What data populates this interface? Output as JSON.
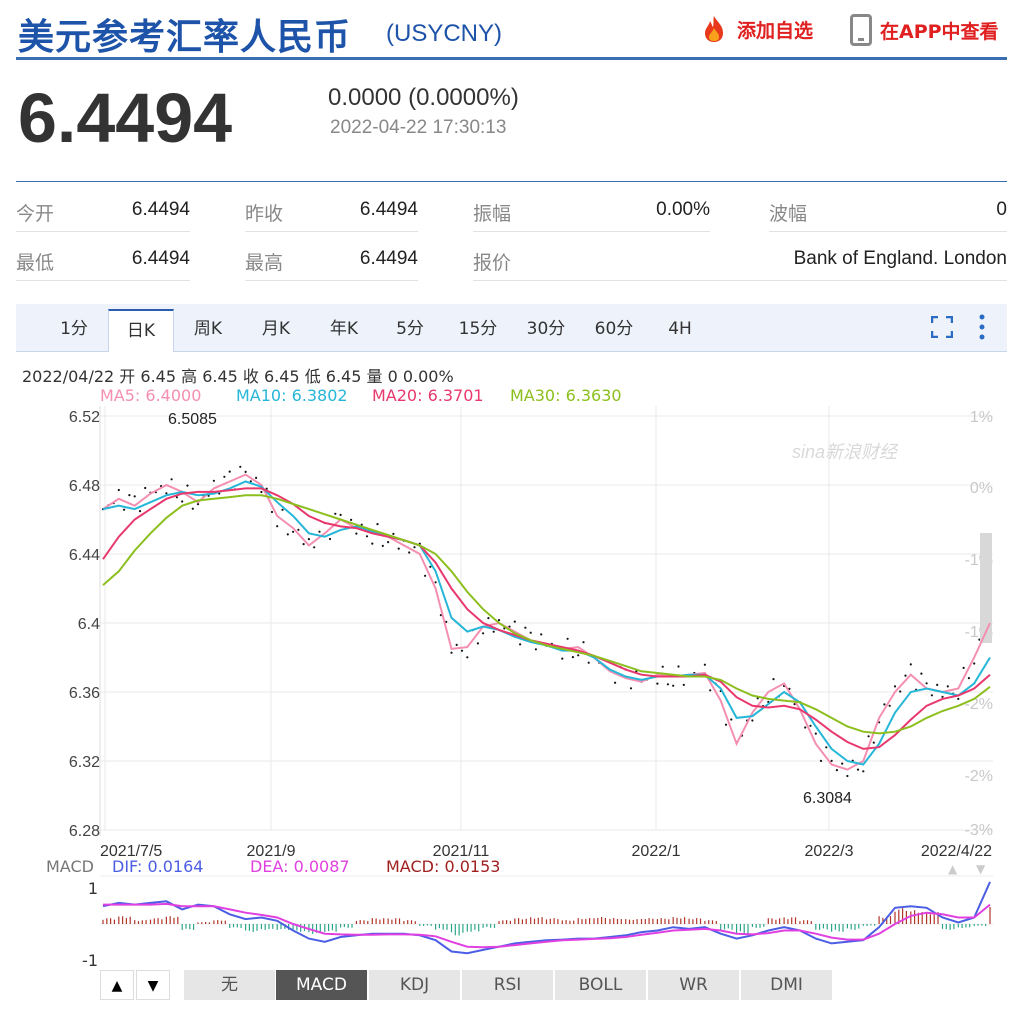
{
  "header": {
    "title": "美元参考汇率人民币",
    "code": "(USYCNY)",
    "add_watch": "添加自选",
    "open_app": "在APP中查看"
  },
  "quote": {
    "price": "6.4494",
    "change": "0.0000 (0.0000%)",
    "timestamp": "2022-04-22 17:30:13"
  },
  "stats": [
    {
      "label": "今开",
      "value": "6.4494"
    },
    {
      "label": "昨收",
      "value": "6.4494"
    },
    {
      "label": "振幅",
      "value": "0.00%"
    },
    {
      "label": "波幅",
      "value": "0"
    },
    {
      "label": "最低",
      "value": "6.4494"
    },
    {
      "label": "最高",
      "value": "6.4494"
    },
    {
      "label": "报价",
      "value": "Bank of England. London"
    }
  ],
  "tabs": [
    "1分",
    "日K",
    "周K",
    "月K",
    "年K",
    "5分",
    "15分",
    "30分",
    "60分",
    "4H"
  ],
  "active_tab": "日K",
  "ohlc_line": "2022/04/22 开 6.45 高 6.45 收 6.45 低 6.45 量 0 0.00%",
  "ma_legend": [
    {
      "text": "MA5: 6.4000",
      "color": "#f48fb1"
    },
    {
      "text": "MA10: 6.3802",
      "color": "#26b6d8"
    },
    {
      "text": "MA20: 6.3701",
      "color": "#e8386d"
    },
    {
      "text": "MA30: 6.3630",
      "color": "#8cbf1e"
    }
  ],
  "watermark": "sina新浪财经",
  "macd_legend": [
    {
      "text": "MACD",
      "color": "#777777"
    },
    {
      "text": "DIF: 0.0164",
      "color": "#4b5ee4"
    },
    {
      "text": "DEA: 0.0087",
      "color": "#e040e0"
    },
    {
      "text": "MACD: 0.0153",
      "color": "#a02020"
    }
  ],
  "indicator_tabs": [
    "无",
    "MACD",
    "KDJ",
    "RSI",
    "BOLL",
    "WR",
    "DMI"
  ],
  "active_indicator": "MACD",
  "arrow_up": "▲",
  "arrow_down": "▼",
  "chart_data": {
    "type": "line",
    "x_ticks": [
      "2021/7/5",
      "2021/9",
      "2021/11",
      "2022/1",
      "2022/3",
      "2022/4/22"
    ],
    "y_ticks": [
      "6.52",
      "6.48",
      "6.44",
      "6.4",
      "6.36",
      "6.32",
      "6.28"
    ],
    "y_right_ticks": [
      "1%",
      "0%",
      "-1%",
      "-1%",
      "-2%",
      "-2%",
      "-3%"
    ],
    "ylim": [
      6.28,
      6.52
    ],
    "annotations": [
      {
        "text": "6.5085",
        "value": 6.5085
      },
      {
        "text": "6.3084",
        "value": 6.3084
      }
    ],
    "series": [
      {
        "name": "MA5",
        "color": "#f48fb1",
        "values": [
          6.466,
          6.472,
          6.468,
          6.475,
          6.48,
          6.476,
          6.47,
          6.478,
          6.482,
          6.486,
          6.48,
          6.462,
          6.455,
          6.445,
          6.452,
          6.46,
          6.455,
          6.452,
          6.45,
          6.445,
          6.44,
          6.42,
          6.385,
          6.386,
          6.398,
          6.4,
          6.395,
          6.39,
          6.388,
          6.385,
          6.386,
          6.38,
          6.372,
          6.368,
          6.366,
          6.37,
          6.369,
          6.37,
          6.371,
          6.355,
          6.33,
          6.348,
          6.36,
          6.365,
          6.35,
          6.33,
          6.318,
          6.315,
          6.32,
          6.345,
          6.36,
          6.37,
          6.362,
          6.36,
          6.362,
          6.38,
          6.4
        ]
      },
      {
        "name": "MA10",
        "color": "#26b6d8",
        "values": [
          6.466,
          6.468,
          6.466,
          6.47,
          6.474,
          6.476,
          6.474,
          6.475,
          6.478,
          6.482,
          6.479,
          6.47,
          6.462,
          6.452,
          6.45,
          6.454,
          6.456,
          6.453,
          6.45,
          6.448,
          6.445,
          6.43,
          6.403,
          6.395,
          6.398,
          6.396,
          6.392,
          6.389,
          6.387,
          6.384,
          6.384,
          6.38,
          6.373,
          6.369,
          6.367,
          6.369,
          6.369,
          6.37,
          6.37,
          6.362,
          6.345,
          6.346,
          6.353,
          6.36,
          6.354,
          6.34,
          6.327,
          6.32,
          6.318,
          6.33,
          6.348,
          6.36,
          6.362,
          6.36,
          6.358,
          6.365,
          6.38
        ]
      },
      {
        "name": "MA20",
        "color": "#e8386d",
        "values": [
          6.437,
          6.45,
          6.46,
          6.466,
          6.472,
          6.475,
          6.476,
          6.476,
          6.477,
          6.478,
          6.478,
          6.474,
          6.469,
          6.462,
          6.458,
          6.456,
          6.455,
          6.452,
          6.45,
          6.448,
          6.445,
          6.435,
          6.42,
          6.408,
          6.4,
          6.396,
          6.393,
          6.39,
          6.388,
          6.386,
          6.384,
          6.381,
          6.377,
          6.373,
          6.37,
          6.369,
          6.369,
          6.369,
          6.37,
          6.366,
          6.357,
          6.352,
          6.351,
          6.352,
          6.35,
          6.344,
          6.337,
          6.331,
          6.327,
          6.328,
          6.335,
          6.344,
          6.352,
          6.356,
          6.358,
          6.362,
          6.37
        ]
      },
      {
        "name": "MA30",
        "color": "#8cbf1e",
        "values": [
          6.422,
          6.43,
          6.442,
          6.452,
          6.461,
          6.468,
          6.471,
          6.472,
          6.473,
          6.474,
          6.474,
          6.472,
          6.469,
          6.466,
          6.463,
          6.46,
          6.457,
          6.454,
          6.451,
          6.448,
          6.445,
          6.44,
          6.43,
          6.418,
          6.408,
          6.4,
          6.394,
          6.39,
          6.387,
          6.385,
          6.383,
          6.381,
          6.378,
          6.375,
          6.372,
          6.371,
          6.37,
          6.369,
          6.369,
          6.367,
          6.362,
          6.358,
          6.356,
          6.355,
          6.354,
          6.35,
          6.345,
          6.34,
          6.337,
          6.336,
          6.337,
          6.34,
          6.345,
          6.349,
          6.352,
          6.356,
          6.363
        ]
      }
    ],
    "macd": {
      "ylim": [
        -1,
        1
      ],
      "y_ticks": [
        "1",
        "-1"
      ],
      "dif": [
        0.55,
        0.65,
        0.6,
        0.65,
        0.7,
        0.45,
        0.6,
        0.55,
        0.3,
        0.15,
        0.2,
        0.1,
        -0.2,
        -0.45,
        -0.55,
        -0.4,
        -0.35,
        -0.3,
        -0.3,
        -0.3,
        -0.35,
        -0.5,
        -0.85,
        -0.9,
        -0.8,
        -0.7,
        -0.6,
        -0.55,
        -0.5,
        -0.48,
        -0.45,
        -0.45,
        -0.4,
        -0.35,
        -0.25,
        -0.2,
        -0.1,
        -0.15,
        -0.1,
        -0.3,
        -0.45,
        -0.35,
        -0.2,
        -0.1,
        -0.2,
        -0.45,
        -0.6,
        -0.55,
        -0.5,
        -0.1,
        0.5,
        0.55,
        0.5,
        0.2,
        0.05,
        0.2,
        1.3
      ],
      "dea": [
        0.6,
        0.6,
        0.6,
        0.6,
        0.62,
        0.55,
        0.55,
        0.55,
        0.45,
        0.35,
        0.28,
        0.2,
        0.0,
        -0.15,
        -0.3,
        -0.32,
        -0.33,
        -0.33,
        -0.32,
        -0.32,
        -0.33,
        -0.38,
        -0.55,
        -0.7,
        -0.72,
        -0.7,
        -0.65,
        -0.6,
        -0.55,
        -0.5,
        -0.48,
        -0.46,
        -0.44,
        -0.4,
        -0.33,
        -0.27,
        -0.2,
        -0.18,
        -0.15,
        -0.2,
        -0.3,
        -0.32,
        -0.28,
        -0.2,
        -0.2,
        -0.3,
        -0.42,
        -0.48,
        -0.48,
        -0.3,
        0.0,
        0.25,
        0.35,
        0.3,
        0.2,
        0.2,
        0.6
      ],
      "hist": [
        0.3,
        0.4,
        0.2,
        0.3,
        0.4,
        -0.3,
        0.1,
        0.2,
        -0.2,
        -0.4,
        -0.3,
        -0.3,
        -0.4,
        -0.5,
        -0.4,
        -0.2,
        0.2,
        0.3,
        0.3,
        0.2,
        -0.1,
        -0.3,
        -0.6,
        -0.4,
        -0.2,
        0.2,
        0.3,
        0.35,
        0.3,
        0.2,
        0.3,
        0.35,
        0.3,
        0.25,
        0.3,
        0.3,
        0.35,
        0.3,
        0.2,
        -0.3,
        -0.5,
        -0.2,
        0.3,
        0.35,
        0.2,
        -0.3,
        -0.4,
        -0.3,
        -0.1,
        0.4,
        0.8,
        0.7,
        0.6,
        -0.3,
        -0.2,
        -0.1,
        1.0
      ]
    }
  }
}
